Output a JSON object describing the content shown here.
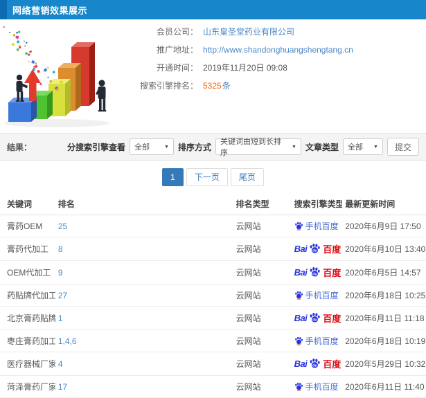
{
  "header": {
    "title": "网络营销效果展示"
  },
  "info": {
    "rows": [
      {
        "label": "会员公司：",
        "value": "山东皇圣堂药业有限公司",
        "kind": "link"
      },
      {
        "label": "推广地址：",
        "value": "http://www.shandonghuangshengtang.cn",
        "kind": "link"
      },
      {
        "label": "开通时间：",
        "value": "2019年11月20日 09:08",
        "kind": "text"
      },
      {
        "label": "搜索引擎排名：",
        "value": "5325",
        "suffix": "条",
        "kind": "count"
      }
    ]
  },
  "filters": {
    "result_label": "结果：",
    "engine_label": "分搜索引擎查看",
    "engine_value": "全部",
    "sort_label": "排序方式",
    "sort_value": "关键词由短到长排序",
    "article_label": "文章类型",
    "article_value": "全部",
    "submit_label": "提交",
    "dropdown_icon": "▼"
  },
  "pagination": {
    "current": "1",
    "next": "下一页",
    "last": "尾页"
  },
  "table": {
    "headers": [
      "关键词",
      "排名",
      "排名类型",
      "搜索引擎类型",
      "最新更新时间"
    ],
    "rows": [
      {
        "keyword": "膏药OEM",
        "rank": "25",
        "rank_type": "云网站",
        "engine": "mobile-baidu",
        "engine_label": "手机百度",
        "time": "2020年6月9日 17:50"
      },
      {
        "keyword": "膏药代加工",
        "rank": "8",
        "rank_type": "云网站",
        "engine": "baidu",
        "engine_label": "百度",
        "time": "2020年6月10日 13:40"
      },
      {
        "keyword": "OEM代加工",
        "rank": "9",
        "rank_type": "云网站",
        "engine": "baidu",
        "engine_label": "百度",
        "time": "2020年6月5日 14:57"
      },
      {
        "keyword": "药贴牌代加工",
        "rank": "27",
        "rank_type": "云网站",
        "engine": "mobile-baidu",
        "engine_label": "手机百度",
        "time": "2020年6月18日 10:25"
      },
      {
        "keyword": "北京膏药贴牌",
        "rank": "1",
        "rank_type": "云网站",
        "engine": "baidu",
        "engine_label": "百度",
        "time": "2020年6月11日 11:18"
      },
      {
        "keyword": "枣庄膏药加工",
        "rank": "1,4,6",
        "rank_type": "云网站",
        "engine": "mobile-baidu",
        "engine_label": "手机百度",
        "time": "2020年6月18日 10:19"
      },
      {
        "keyword": "医疗器械厂家",
        "rank": "4",
        "rank_type": "云网站",
        "engine": "baidu",
        "engine_label": "百度",
        "time": "2020年5月29日 10:32"
      },
      {
        "keyword": "菏泽膏药厂家",
        "rank": "17",
        "rank_type": "云网站",
        "engine": "mobile-baidu",
        "engine_label": "手机百度",
        "time": "2020年6月11日 11:40"
      }
    ],
    "engine_prefix_baidu": "Bai"
  },
  "colors": {
    "header_blue": "#1786ca",
    "header_accent": "#0d6cb1",
    "link_blue": "#4a87c8",
    "count_orange": "#ff6600",
    "baidu_blue": "#2633dd",
    "baidu_red": "#dd0a12",
    "active_page": "#3579b8"
  }
}
